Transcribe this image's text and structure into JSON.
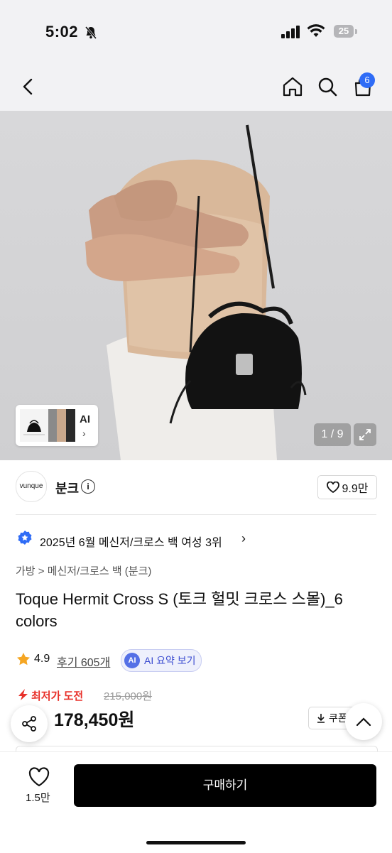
{
  "status_bar": {
    "time": "5:02",
    "battery": "25"
  },
  "nav": {
    "cart_count": "6"
  },
  "gallery": {
    "thumb_ai_label": "AI",
    "thumb_chevron": "›",
    "pager": "1 / 9"
  },
  "brand": {
    "logo_text": "vunque",
    "name": "분크",
    "info": "i",
    "likes": "9.9만"
  },
  "ranking": {
    "text": "2025년 6월 메신저/크로스 백 여성 3위",
    "chevron": "›"
  },
  "breadcrumb": "가방 > 메신저/크로스 백 (분크)",
  "product": {
    "title": "Toque Hermit Cross S (토크 헐밋 크로스 스몰)_6 colors"
  },
  "rating": {
    "score": "4.9",
    "reviews": "후기 605개",
    "ai_badge": "AI",
    "ai_summary": "AI 요약 보기"
  },
  "price": {
    "lowest_label": "최저가 도전",
    "original": "215,000원",
    "current": "178,450원",
    "coupon": "쿠폰 받기"
  },
  "bottom_bar": {
    "wishlist_count": "1.5만",
    "buy_label": "구매하기"
  },
  "colors": {
    "accent": "#2f6cf6",
    "sale_red": "#e8312a",
    "buy_button": "#000000"
  }
}
